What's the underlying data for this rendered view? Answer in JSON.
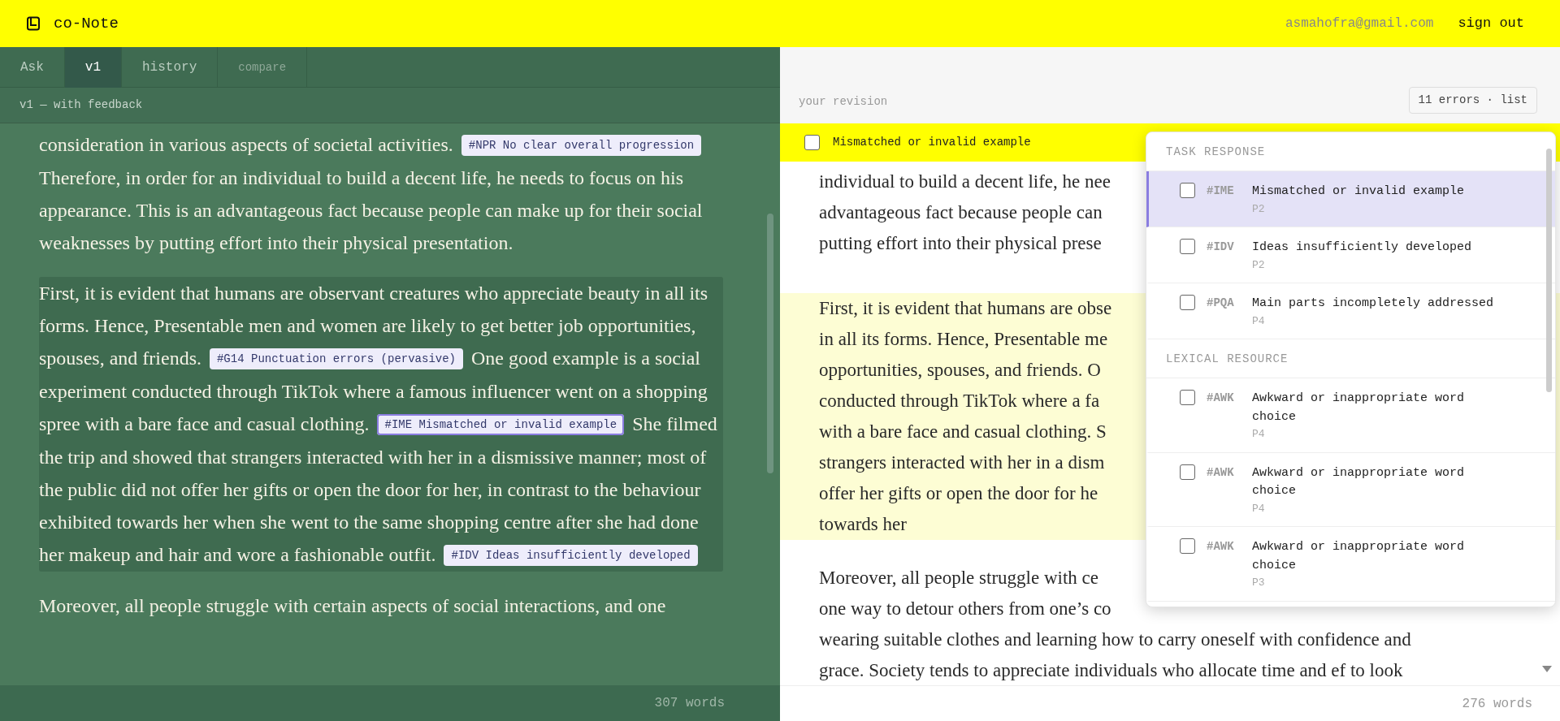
{
  "header": {
    "app_name": "co-Note",
    "email": "asmahofra@gmail.com",
    "sign_out": "sign out"
  },
  "left_panel": {
    "tabs": [
      {
        "label": "Ask",
        "selected": false,
        "disabled": false
      },
      {
        "label": "v1",
        "selected": true,
        "disabled": false
      },
      {
        "label": "history",
        "selected": false,
        "disabled": false
      },
      {
        "label": "compare",
        "selected": false,
        "disabled": true
      }
    ],
    "subtitle": "v1 — with feedback",
    "paragraphs": [
      {
        "highlighted": false,
        "segments": [
          {
            "kind": "text",
            "text": "consideration in various aspects of societal activities."
          },
          {
            "kind": "tag",
            "code": "#NPR",
            "label": "No clear overall progression",
            "selected": false
          },
          {
            "kind": "text",
            "text": "Therefore, in order for an individual to build a decent life, he needs to focus on his appearance. This is an advantageous fact because people can make up for their social weaknesses by putting effort into their physical presentation."
          }
        ]
      },
      {
        "highlighted": true,
        "segments": [
          {
            "kind": "text",
            "text": "First, it is evident that humans are observant creatures who appreciate beauty in all its forms. Hence, Presentable men and women are likely to get better job opportunities, spouses, and friends."
          },
          {
            "kind": "tag",
            "code": "#G14",
            "label": "Punctuation errors (pervasive)",
            "selected": false
          },
          {
            "kind": "text",
            "text": "One good example is a social experiment conducted through TikTok where a famous influencer went on a shopping spree with a bare face and casual clothing."
          },
          {
            "kind": "tag",
            "code": "#IME",
            "label": "Mismatched or invalid example",
            "selected": true
          },
          {
            "kind": "text",
            "text": "She filmed the trip and showed that strangers interacted with her in a dismissive manner; most of the public did not offer her gifts or open the door for her, in contrast to the behaviour exhibited towards her when she went to the same shopping centre after she had done her makeup and hair and wore a fashionable outfit."
          },
          {
            "kind": "tag",
            "code": "#IDV",
            "label": "Ideas insufficiently developed",
            "selected": false
          }
        ]
      },
      {
        "highlighted": false,
        "segments": [
          {
            "kind": "text",
            "text": "Moreover, all people struggle with certain aspects of social interactions, and one"
          }
        ]
      }
    ],
    "word_count": "307 words"
  },
  "right_panel": {
    "subtitle": "your revision",
    "errors_button": "11 errors · list",
    "focus_bar": {
      "checked": false,
      "label": "Mismatched or invalid example"
    },
    "paragraphs": [
      {
        "highlighted": false,
        "lines": [
          "individual to build a decent life, he nee",
          "advantageous fact because people can",
          "putting effort into their physical prese"
        ]
      },
      {
        "highlighted": true,
        "lines": [
          "First, it is evident that humans are obse",
          "in all its forms. Hence, Presentable me",
          "opportunities, spouses, and friends. O",
          "conducted through TikTok where a fa",
          "with a bare face and casual clothing. S",
          "strangers interacted with her in a dism",
          "offer her gifts or open the door for he",
          "towards her"
        ]
      },
      {
        "highlighted": false,
        "lines": [
          "Moreover, all  people struggle with ce",
          "one way to detour others from one’s co",
          "wearing suitable clothes and learning how to carry oneself with confidence and",
          "grace. Society tends to appreciate individuals who allocate time and ef to look"
        ]
      }
    ],
    "word_count": "276 words",
    "error_list": {
      "sections": [
        {
          "title": "TASK RESPONSE",
          "items": [
            {
              "code": "#IME",
              "label": "Mismatched or invalid example",
              "paragraph": "P2",
              "checked": false,
              "selected": true
            },
            {
              "code": "#IDV",
              "label": "Ideas insufficiently developed",
              "paragraph": "P2",
              "checked": false,
              "selected": false
            },
            {
              "code": "#PQA",
              "label": "Main parts incompletely addressed",
              "paragraph": "P4",
              "checked": false,
              "selected": false
            }
          ]
        },
        {
          "title": "LEXICAL RESOURCE",
          "items": [
            {
              "code": "#AWK",
              "label": "Awkward or inappropriate word choice",
              "paragraph": "P4",
              "checked": false,
              "selected": false
            },
            {
              "code": "#AWK",
              "label": "Awkward or inappropriate word choice",
              "paragraph": "P4",
              "checked": false,
              "selected": false
            },
            {
              "code": "#AWK",
              "label": "Awkward or inappropriate word choice",
              "paragraph": "P3",
              "checked": false,
              "selected": false
            }
          ]
        }
      ]
    }
  }
}
